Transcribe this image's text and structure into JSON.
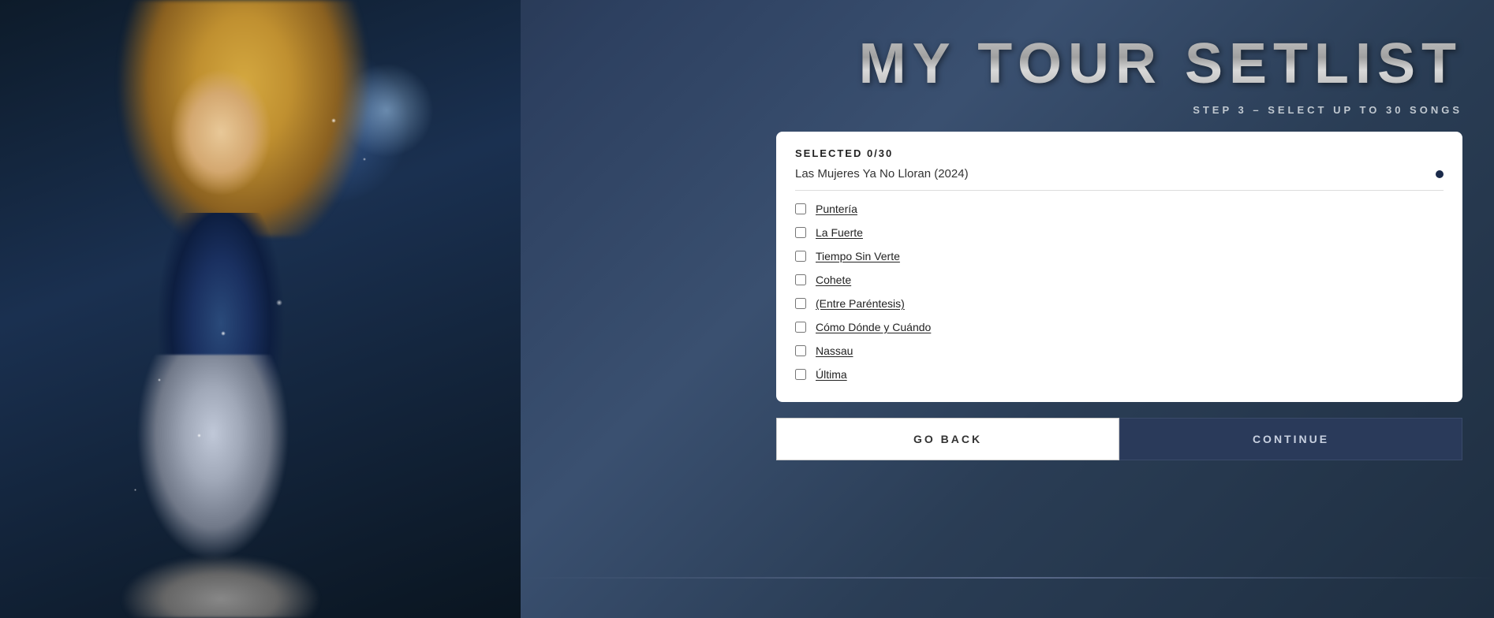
{
  "page": {
    "title": "MY TOUR SETLIST",
    "step_label": "STEP 3 – SELECT UP TO 30 SONGS",
    "selected_count": "SELECTED 0/30",
    "album_name": "Las Mujeres Ya No Lloran (2024)"
  },
  "songs": [
    {
      "id": 1,
      "title": "Puntería",
      "checked": false
    },
    {
      "id": 2,
      "title": "La Fuerte",
      "checked": false
    },
    {
      "id": 3,
      "title": "Tiempo Sin Verte",
      "checked": false
    },
    {
      "id": 4,
      "title": "Cohete",
      "checked": false
    },
    {
      "id": 5,
      "title": "(Entre Paréntesis)",
      "checked": false
    },
    {
      "id": 6,
      "title": "Cómo Dónde y Cuándo",
      "checked": false
    },
    {
      "id": 7,
      "title": "Nassau",
      "checked": false
    },
    {
      "id": 8,
      "title": "Última",
      "checked": false
    }
  ],
  "buttons": {
    "back_label": "GO BACK",
    "continue_label": "CONTINUE"
  },
  "colors": {
    "bg_dark": "#1a2535",
    "bg_mid": "#2d4060",
    "card_bg": "#ffffff",
    "continue_bg": "#2a3a5a",
    "title_color": "#c8c8c8"
  }
}
